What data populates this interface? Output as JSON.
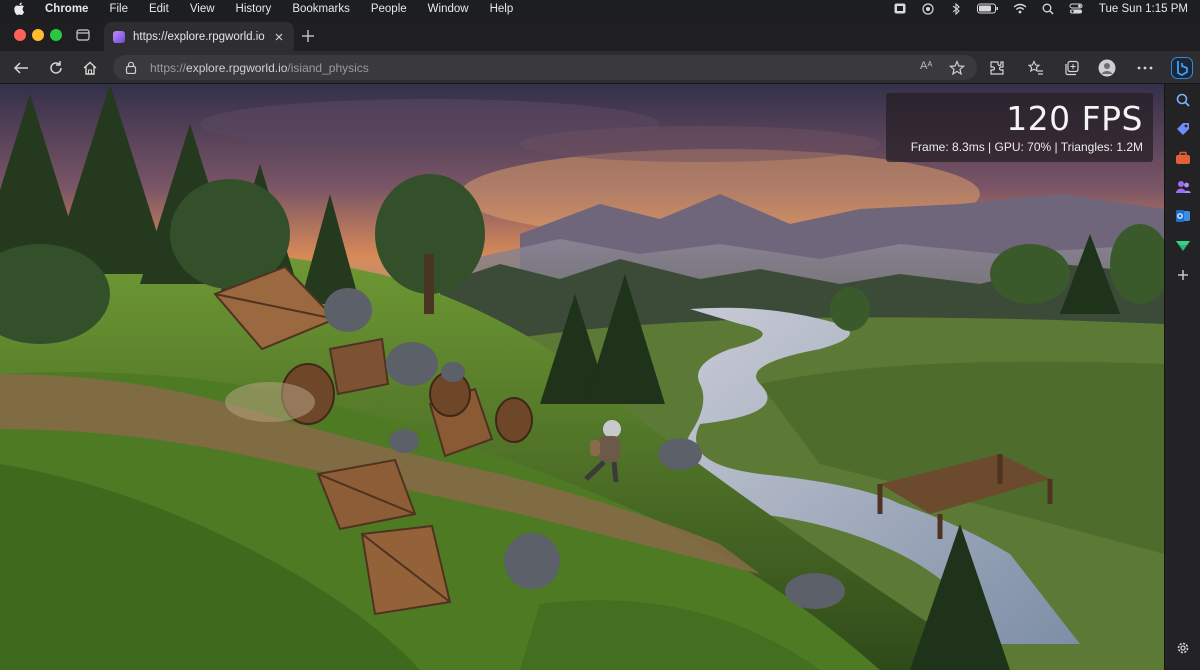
{
  "menubar": {
    "app_name": "Chrome",
    "items": [
      "File",
      "Edit",
      "View",
      "History",
      "Bookmarks",
      "People",
      "Window",
      "Help"
    ],
    "clock": "Tue Sun 1:15 PM",
    "status_icons": [
      "app-icon",
      "record-icon",
      "bluetooth-icon",
      "battery-icon",
      "wifi-icon",
      "search-icon",
      "control-center-icon"
    ]
  },
  "tab": {
    "title": "https://explore.rpgworld.io",
    "favicon": "rpgworld-favicon"
  },
  "toolbar": {
    "url_scheme": "https://",
    "url_host": "explore.rpgworld.io",
    "url_path": "/isiand_physics",
    "read_aloud_label": "Aᴬ"
  },
  "overlay": {
    "fps": "120 FPS",
    "stats": "Frame: 8.3ms | GPU: 70% | Triangles: 1.2M"
  },
  "sidebar": {
    "icons": [
      "search-icon",
      "shopping-tag-icon",
      "briefcase-icon",
      "people-icon",
      "outlook-icon",
      "drive-icon",
      "add-icon",
      "settings-icon"
    ]
  },
  "colors": {
    "sky_top": "#3a3550",
    "sky_glow": "#e59a5a",
    "grass": "#5f8a2e",
    "river": "#b9c4d4",
    "crate": "#8a5a36",
    "bing_accent": "#2b8de0"
  }
}
